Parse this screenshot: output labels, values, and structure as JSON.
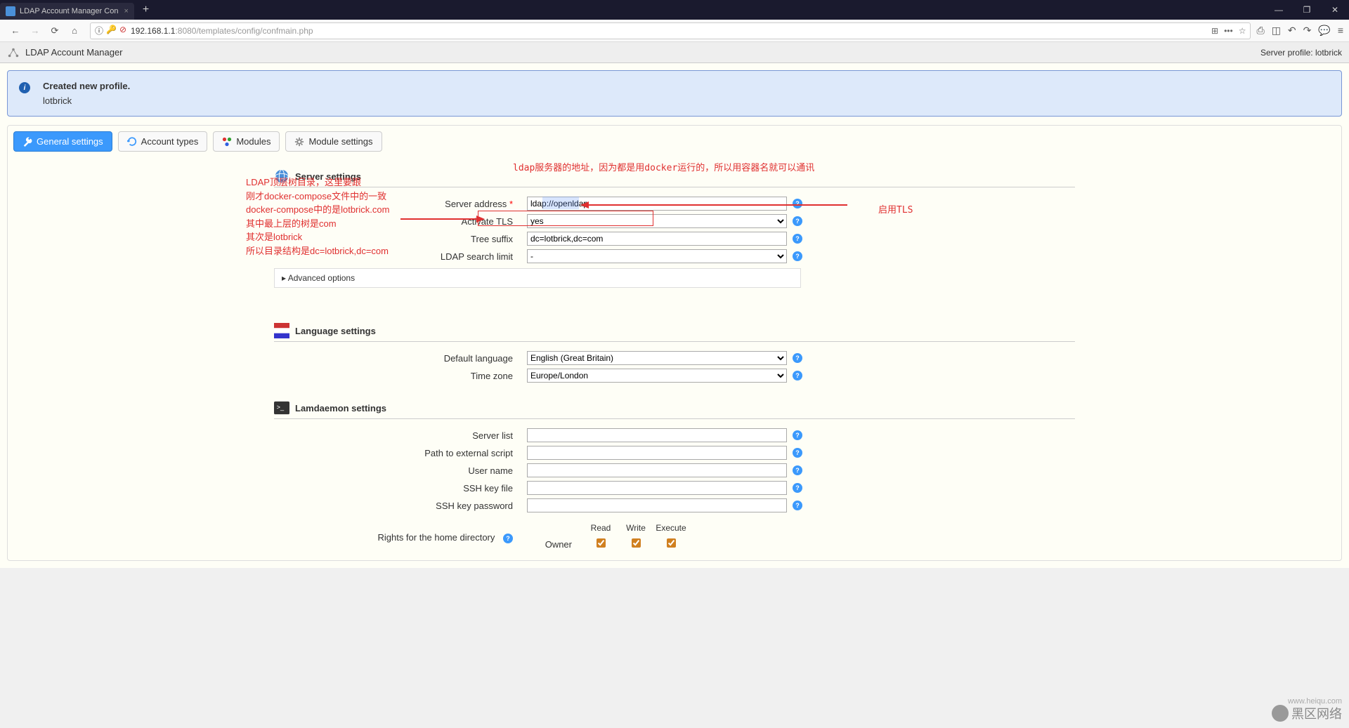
{
  "browser": {
    "tab_title": "LDAP Account Manager Con",
    "url_prefix": "192.168.1.1",
    "url_suffix": ":8080/templates/config/confmain.php"
  },
  "app": {
    "title": "LDAP Account Manager",
    "server_profile_label": "Server profile:",
    "server_profile_value": "lotbrick"
  },
  "message": {
    "title": "Created new profile.",
    "body": "lotbrick"
  },
  "tabs": {
    "general": "General settings",
    "account_types": "Account types",
    "modules": "Modules",
    "module_settings": "Module settings"
  },
  "sections": {
    "server": {
      "title": "Server settings",
      "server_address_label": "Server address",
      "server_address_value": "ldap://openldap",
      "activate_tls_label": "Activate TLS",
      "activate_tls_value": "yes",
      "tree_suffix_label": "Tree suffix",
      "tree_suffix_value": "dc=lotbrick,dc=com",
      "search_limit_label": "LDAP search limit",
      "search_limit_value": "-",
      "advanced_options": "▸ Advanced options"
    },
    "language": {
      "title": "Language settings",
      "default_lang_label": "Default language",
      "default_lang_value": "English (Great Britain)",
      "timezone_label": "Time zone",
      "timezone_value": "Europe/London"
    },
    "lamdaemon": {
      "title": "Lamdaemon settings",
      "server_list_label": "Server list",
      "script_path_label": "Path to external script",
      "user_name_label": "User name",
      "ssh_key_label": "SSH key file",
      "ssh_pass_label": "SSH key password",
      "rights_label": "Rights for the home directory",
      "read": "Read",
      "write": "Write",
      "execute": "Execute",
      "owner": "Owner"
    }
  },
  "annotations": {
    "ldap_addr": "ldap服务器的地址，因为都是用docker运行的，所以用容器名就可以通讯",
    "tls": "启用TLS",
    "tree1": "LDAP顶层树目录，这里要跟",
    "tree2": "刚才docker-compose文件中的一致",
    "tree3": "docker-compose中的是lotbrick.com",
    "tree4": "其中最上层的树是com",
    "tree5": "其次是lotbrick",
    "tree6": "所以目录结构是dc=lotbrick,dc=com"
  },
  "watermark": {
    "text": "黑区网络",
    "url": "www.heiqu.com"
  }
}
